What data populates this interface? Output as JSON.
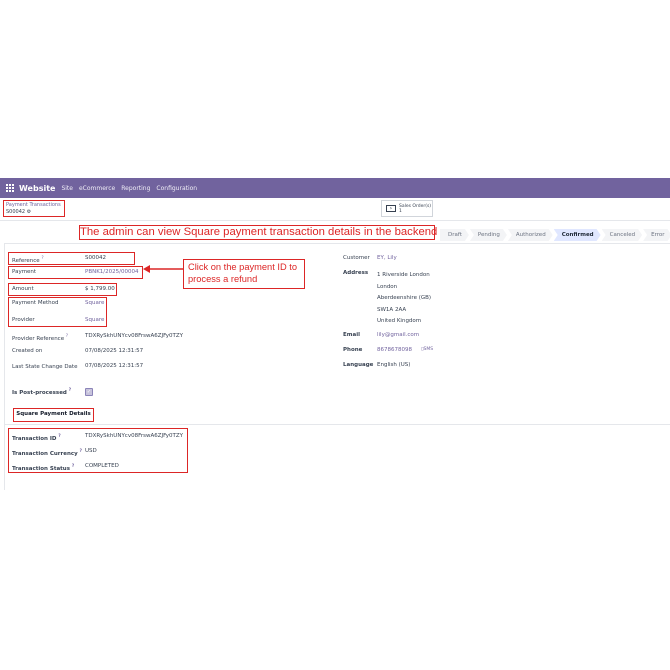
{
  "navbar": {
    "app": "Website",
    "items": [
      "Site",
      "eCommerce",
      "Reporting",
      "Configuration"
    ]
  },
  "breadcrumb": {
    "parent": "Payment Transactions",
    "current": "S00042"
  },
  "smart_button": {
    "label": "Sales Order(s)",
    "count": "1"
  },
  "annotation": {
    "title": "The admin can view Square payment transaction details in the backend",
    "callout": "Click on the payment ID to process a refund"
  },
  "status": {
    "stages": [
      "Draft",
      "Pending",
      "Authorized",
      "Confirmed",
      "Canceled",
      "Error"
    ],
    "active": "Confirmed"
  },
  "left": {
    "reference_label": "Reference",
    "reference": "S00042",
    "payment_label": "Payment",
    "payment": "PBNK1/2025/00004",
    "amount_label": "Amount",
    "amount": "$ 1,799.00",
    "method_label": "Payment Method",
    "method": "Square",
    "provider_label": "Provider",
    "provider": "Square",
    "provider_ref_label": "Provider Reference",
    "provider_ref": "TDXRySkhUNYcv08FrswA6ZJFy0TZY",
    "created_label": "Created on",
    "created": "07/08/2025 12:31:57",
    "last_change_label": "Last State Change Date",
    "last_change": "07/08/2025 12:31:57",
    "post_label": "Is Post-processed"
  },
  "right": {
    "customer_label": "Customer",
    "customer": "EY, Lily",
    "address_label": "Address",
    "address": [
      "1 Riverside London",
      "London",
      "Aberdeenshire (GB)",
      "SW1A 2AA",
      "United Kingdom"
    ],
    "email_label": "Email",
    "email": "lily@gmail.com",
    "phone_label": "Phone",
    "phone": "8678678098",
    "sms": "SMS",
    "language_label": "Language",
    "language": "English (US)"
  },
  "tab": {
    "label": "Square Payment Details"
  },
  "square": {
    "txid_label": "Transaction ID",
    "txid": "TDXRySkhUNYcv08FrswA6ZJFy0TZY",
    "currency_label": "Transaction Currency",
    "currency": "USD",
    "status_label": "Transaction Status",
    "status": "COMPLETED"
  },
  "colors": {
    "brand": "#71639e",
    "annotation": "#dc2626"
  }
}
